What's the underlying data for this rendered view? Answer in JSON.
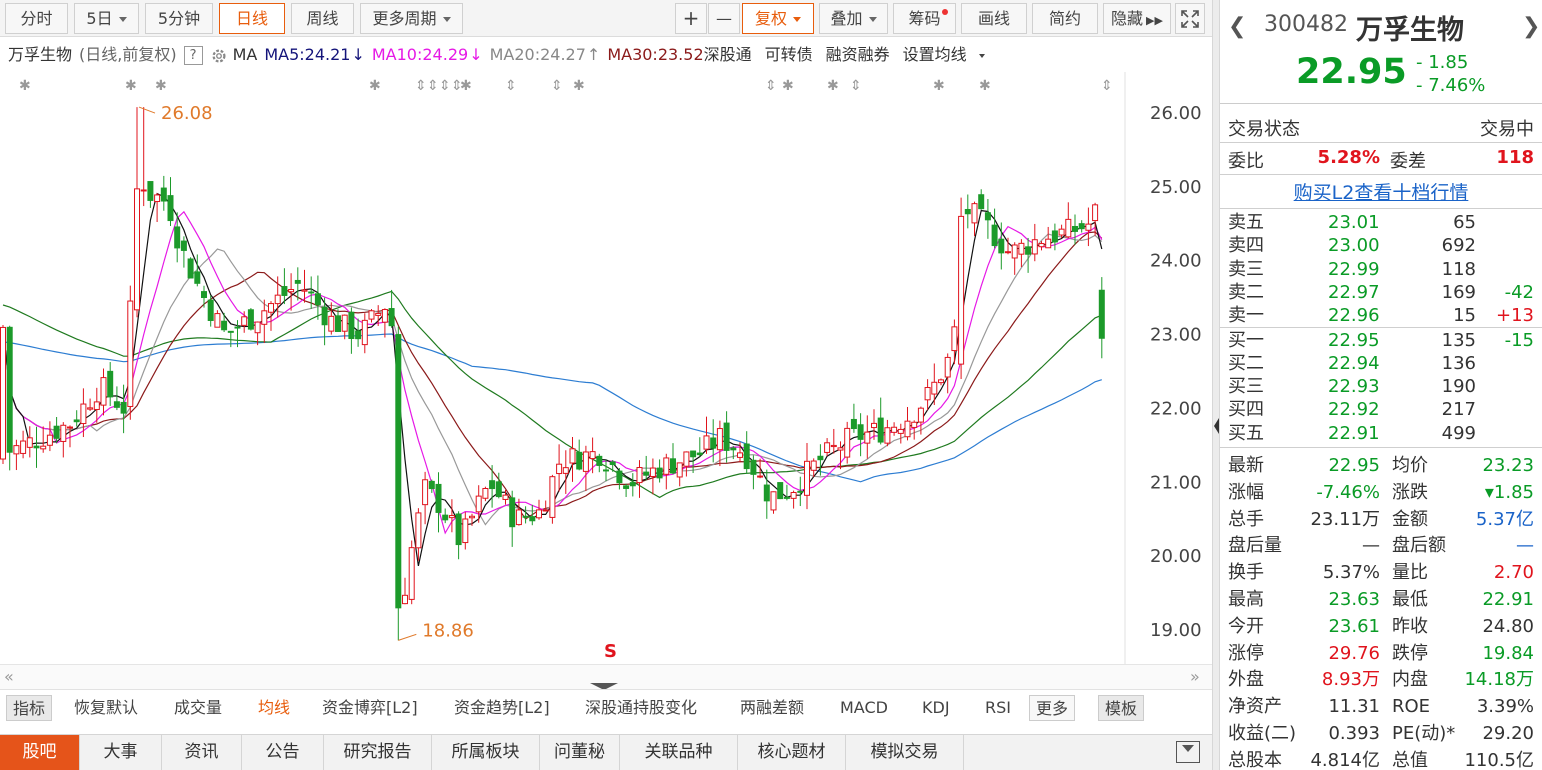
{
  "toolbar": {
    "tabs": [
      "分时",
      "5日",
      "5分钟",
      "日线",
      "周线",
      "更多周期"
    ],
    "active_tab": "日线",
    "right_buttons": [
      "+",
      "—",
      "复权",
      "叠加",
      "筹码",
      "画线",
      "简约",
      "隐藏"
    ],
    "fullscreen_icon": "fullscreen-icon"
  },
  "legend": {
    "name": "万孚生物",
    "mode": "(日线,前复权)",
    "help": "?",
    "ma_label": "MA",
    "ma5": "MA5:24.21",
    "ma10": "MA10:24.29",
    "ma20": "MA20:24.27",
    "ma30": "MA30:23.52",
    "links": [
      "深股通",
      "可转债",
      "融资融券",
      "设置均线"
    ],
    "colors": {
      "ma5": "#14147a",
      "ma10": "#e619e6",
      "ma20": "#888888",
      "ma30": "#8b1a1a"
    }
  },
  "chart_data": {
    "type": "candlestick",
    "y_ticks": [
      "26.00",
      "25.00",
      "24.00",
      "23.00",
      "22.00",
      "21.00",
      "20.00",
      "19.00"
    ],
    "ylim": [
      18.65,
      26.15
    ],
    "max_label": "26.08",
    "min_label": "18.86",
    "up_color": "#e0141d",
    "down_color": "#1c9a2a",
    "ma_colors": {
      "ma5": "#111111",
      "ma10": "#e619e6",
      "ma20": "#999999",
      "ma30": "#8b1a1a",
      "ma60": "#1f7a1f",
      "ma120": "#2d7dd2"
    },
    "marker_s": "S"
  },
  "subtabs": [
    "指标",
    "恢复默认",
    "成交量",
    "均线",
    "资金博弈[L2]",
    "资金趋势[L2]",
    "深股通持股变化",
    "两融差额",
    "MACD",
    "KDJ",
    "RSI",
    "更多",
    "模板"
  ],
  "subtabs_active": "均线",
  "bottom_tabs": [
    "股吧",
    "大事",
    "资讯",
    "公告",
    "研究报告",
    "所属板块",
    "问董秘",
    "关联品种",
    "核心题材",
    "模拟交易"
  ],
  "quote": {
    "code": "300482",
    "name": "万孚生物",
    "price": "22.95",
    "change": "- 1.85",
    "change_pct": "- 7.46%",
    "status_label": "交易状态",
    "status_value": "交易中",
    "weibi_label": "委比",
    "weibi_value": "5.28%",
    "weicha_label": "委差",
    "weicha_value": "118",
    "l2_link": "购买L2查看十档行情",
    "asks": [
      {
        "label": "卖五",
        "price": "23.01",
        "vol": "65",
        "chg": ""
      },
      {
        "label": "卖四",
        "price": "23.00",
        "vol": "692",
        "chg": ""
      },
      {
        "label": "卖三",
        "price": "22.99",
        "vol": "118",
        "chg": ""
      },
      {
        "label": "卖二",
        "price": "22.97",
        "vol": "169",
        "chg": "-42"
      },
      {
        "label": "卖一",
        "price": "22.96",
        "vol": "15",
        "chg": "+13"
      }
    ],
    "bids": [
      {
        "label": "买一",
        "price": "22.95",
        "vol": "135",
        "chg": "-15"
      },
      {
        "label": "买二",
        "price": "22.94",
        "vol": "136",
        "chg": ""
      },
      {
        "label": "买三",
        "price": "22.93",
        "vol": "190",
        "chg": ""
      },
      {
        "label": "买四",
        "price": "22.92",
        "vol": "217",
        "chg": ""
      },
      {
        "label": "买五",
        "price": "22.91",
        "vol": "499",
        "chg": ""
      }
    ],
    "stats": [
      {
        "l1": "最新",
        "v1": "22.95",
        "c1": "green",
        "l2": "均价",
        "v2": "23.23",
        "c2": "green"
      },
      {
        "l1": "涨幅",
        "v1": "-7.46%",
        "c1": "green",
        "l2": "涨跌",
        "v2": "▾1.85",
        "c2": "green"
      },
      {
        "l1": "总手",
        "v1": "23.11万",
        "c1": "",
        "l2": "金额",
        "v2": "5.37亿",
        "c2": "blue"
      },
      {
        "l1": "盘后量",
        "v1": "—",
        "c1": "",
        "l2": "盘后额",
        "v2": "—",
        "c2": "blue"
      },
      {
        "l1": "换手",
        "v1": "5.37%",
        "c1": "",
        "l2": "量比",
        "v2": "2.70",
        "c2": "red"
      },
      {
        "l1": "最高",
        "v1": "23.63",
        "c1": "green",
        "l2": "最低",
        "v2": "22.91",
        "c2": "green"
      },
      {
        "l1": "今开",
        "v1": "23.61",
        "c1": "green",
        "l2": "昨收",
        "v2": "24.80",
        "c2": ""
      },
      {
        "l1": "涨停",
        "v1": "29.76",
        "c1": "red",
        "l2": "跌停",
        "v2": "19.84",
        "c2": "green"
      },
      {
        "l1": "外盘",
        "v1": "8.93万",
        "c1": "red",
        "l2": "内盘",
        "v2": "14.18万",
        "c2": "green"
      },
      {
        "l1": "净资产",
        "v1": "11.31",
        "c1": "",
        "l2": "ROE",
        "v2": "3.39%",
        "c2": ""
      },
      {
        "l1": "收益(二)",
        "v1": "0.393",
        "c1": "",
        "l2": "PE(动)*",
        "v2": "29.20",
        "c2": ""
      },
      {
        "l1": "总股本",
        "v1": "4.814亿",
        "c1": "",
        "l2": "总值",
        "v2": "110.5亿",
        "c2": ""
      }
    ]
  }
}
